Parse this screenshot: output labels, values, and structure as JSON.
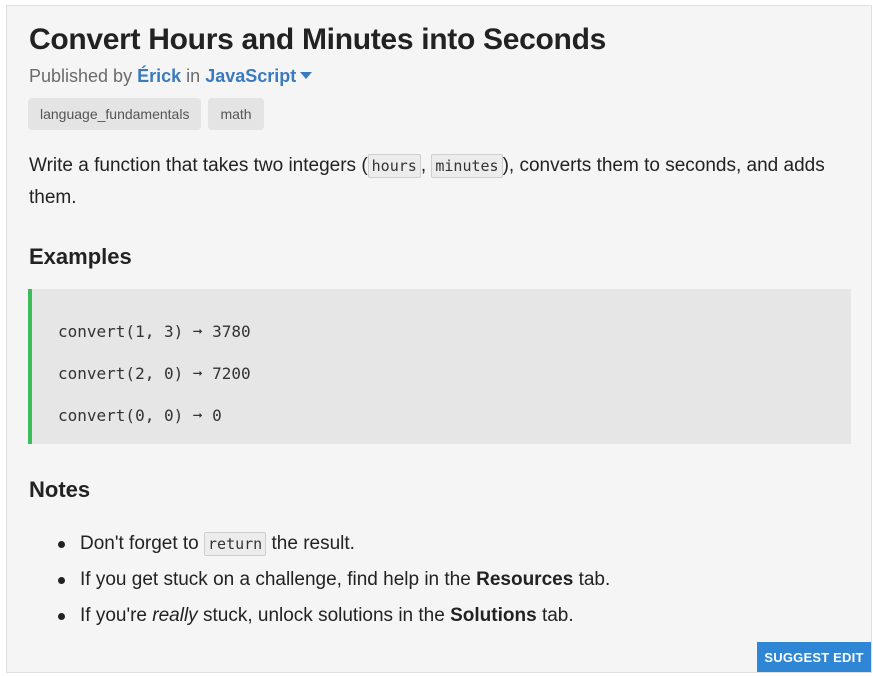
{
  "challenge": {
    "title": "Convert Hours and Minutes into Seconds",
    "published_prefix": "Published by",
    "author": "Érick",
    "in_word": "in",
    "language": "JavaScript"
  },
  "tags": [
    "language_fundamentals",
    "math"
  ],
  "description": {
    "part1": "Write a function that takes two integers (",
    "code1": "hours",
    "sep": ",",
    "code2": "minutes",
    "part2": "), converts them to seconds, and adds them."
  },
  "examples": {
    "heading": "Examples",
    "lines": [
      "convert(1, 3) ➞ 3780",
      "convert(2, 0) ➞ 7200",
      "convert(0, 0) ➞ 0"
    ]
  },
  "notes": {
    "heading": "Notes",
    "note1": {
      "pre": "Don't forget to",
      "code": "return",
      "post": "the result."
    },
    "note2": {
      "pre": "If you get stuck on a challenge, find help in the",
      "bold": "Resources",
      "post": "tab."
    },
    "note3": {
      "pre": "If you're",
      "em": "really",
      "mid": "stuck, unlock solutions in the",
      "bold": "Solutions",
      "post": "tab."
    }
  },
  "actions": {
    "suggest_edit": "SUGGEST EDIT"
  },
  "colors": {
    "accent_link": "#3a7bbf",
    "example_border": "#3dbd58",
    "button_bg": "#2f86d4"
  }
}
